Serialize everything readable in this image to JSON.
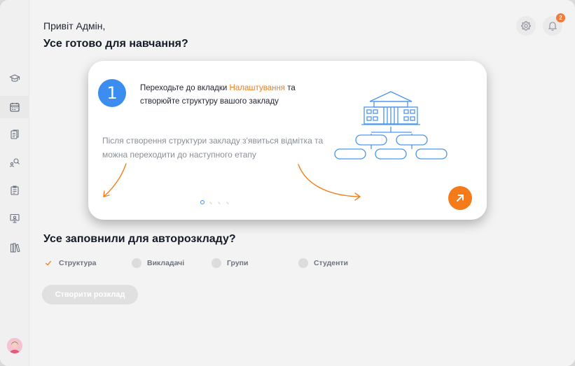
{
  "header": {
    "greeting": "Привіт Адмін,",
    "title": "Усе готово для навчання?",
    "notification_count": "2",
    "settings_icon": "gear-icon",
    "notifications_icon": "bell-icon"
  },
  "sidebar": {
    "items": [
      {
        "icon": "graduation-cap-icon",
        "active": false
      },
      {
        "icon": "calendar-icon",
        "active": true
      },
      {
        "icon": "documents-icon",
        "active": false
      },
      {
        "icon": "user-search-icon",
        "active": false
      },
      {
        "icon": "clipboard-icon",
        "active": false
      },
      {
        "icon": "presentation-icon",
        "active": false
      },
      {
        "icon": "books-icon",
        "active": false
      }
    ],
    "avatar_icon": "user-avatar"
  },
  "onboarding": {
    "step_number": "1",
    "text_before": "Переходьте до вкладки ",
    "text_accent": "Налаштування",
    "text_after": " та створюйте структуру вашого закладу",
    "note": "Після створення структури закладу з'явиться відмітка та можна переходити до наступного етапу",
    "slides_total": 4,
    "current_slide": 1,
    "next_icon": "arrow-up-right-icon"
  },
  "autoschedule": {
    "title": "Усе заповнили для авторозкладу?",
    "checks": [
      {
        "label": "Структура",
        "done": true
      },
      {
        "label": "Викладачі",
        "done": false
      },
      {
        "label": "Групи",
        "done": false
      },
      {
        "label": "Студенти",
        "done": false
      }
    ],
    "create_button": "Створити розклад"
  },
  "colors": {
    "accent_orange": "#f47a1a",
    "accent_blue": "#3b8ef0",
    "badge": "#f47a3a"
  }
}
